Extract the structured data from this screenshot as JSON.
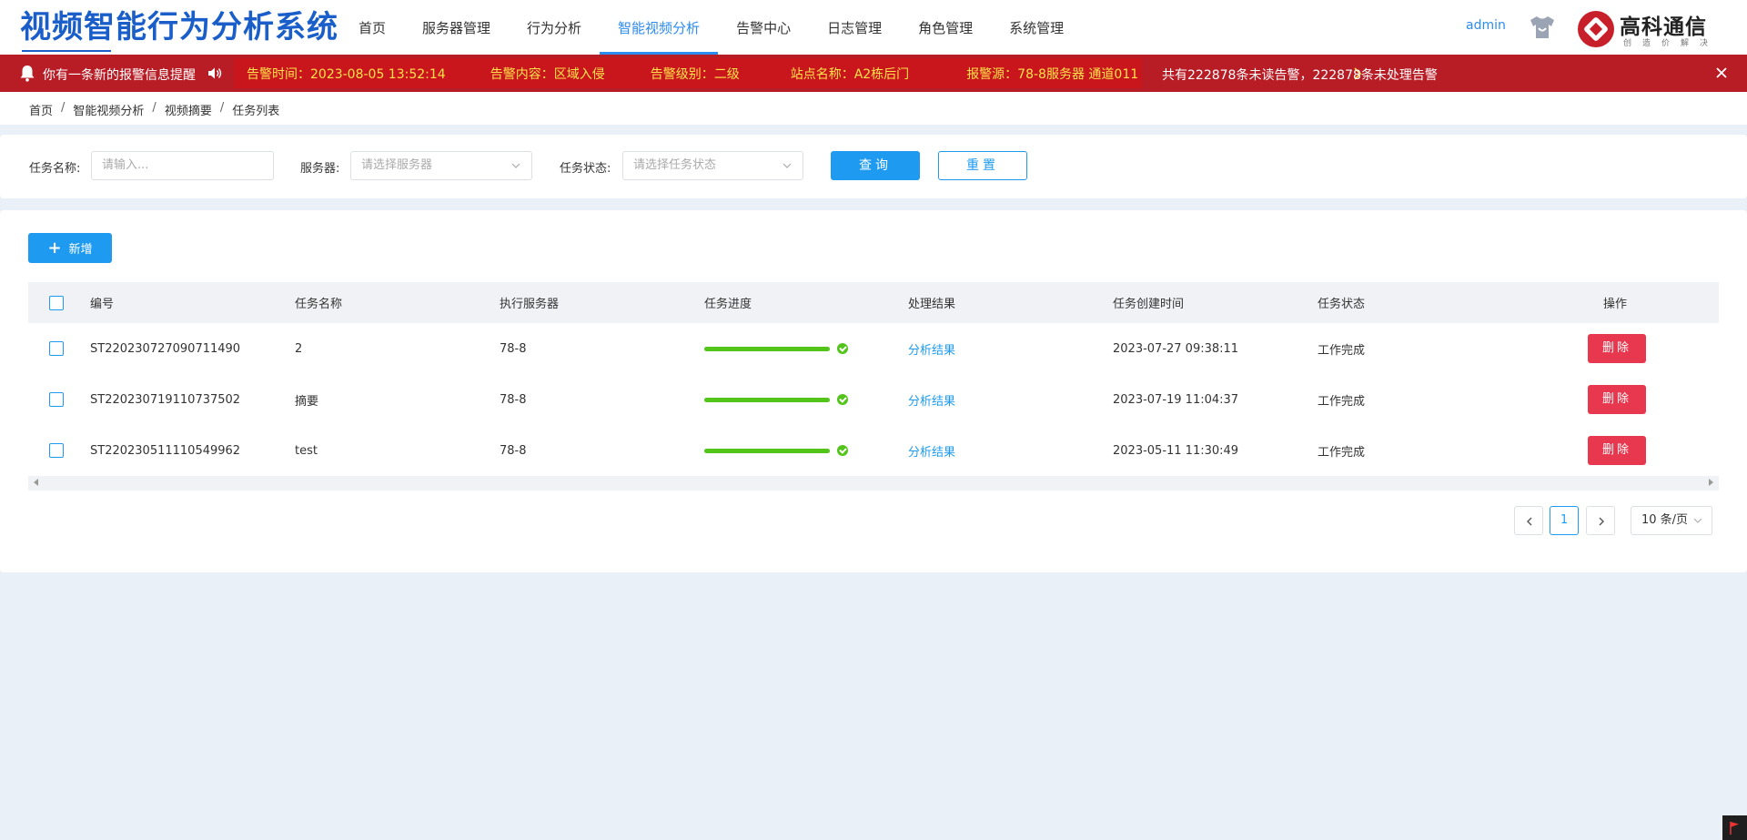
{
  "header": {
    "app_title": "视频智能行为分析系统",
    "nav": [
      "首页",
      "服务器管理",
      "行为分析",
      "智能视频分析",
      "告警中心",
      "日志管理",
      "角色管理",
      "系统管理"
    ],
    "active_nav": "智能视频分析",
    "user": "admin",
    "logo_text": "高科通信",
    "logo_slogan": "创造价解决"
  },
  "alarm": {
    "tip": "你有一条新的报警信息提醒",
    "time": "告警时间：2023-08-05 13:52:14",
    "content": "告警内容：区域入侵",
    "level": "告警级别：二级",
    "site": "站点名称：A2栋后门",
    "source": "报警源：78-8服务器 通道011",
    "summary": "共有222878条未读告警，222878条未处理告警"
  },
  "breadcrumb": [
    "首页",
    "智能视频分析",
    "视频摘要",
    "任务列表"
  ],
  "search": {
    "task_name_label": "任务名称:",
    "task_name_placeholder": "请输入...",
    "server_label": "服务器:",
    "server_placeholder": "请选择服务器",
    "status_label": "任务状态:",
    "status_placeholder": "请选择任务状态",
    "query_label": "查询",
    "reset_label": "重置"
  },
  "toolbar": {
    "add_label": "新增"
  },
  "table": {
    "columns": [
      "编号",
      "任务名称",
      "执行服务器",
      "任务进度",
      "处理结果",
      "任务创建时间",
      "任务状态",
      "操作"
    ],
    "rows": [
      {
        "id": "ST220230727090711490",
        "name": "2",
        "server": "78-8",
        "progress": 1.0,
        "result": "分析结果",
        "created": "2023-07-27 09:38:11",
        "status": "工作完成",
        "action": "删除"
      },
      {
        "id": "ST220230719110737502",
        "name": "摘要",
        "server": "78-8",
        "progress": 1.0,
        "result": "分析结果",
        "created": "2023-07-19 11:04:37",
        "status": "工作完成",
        "action": "删除"
      },
      {
        "id": "ST220230511110549962",
        "name": "test",
        "server": "78-8",
        "progress": 1.0,
        "result": "分析结果",
        "created": "2023-05-11 11:30:49",
        "status": "工作完成",
        "action": "删除"
      }
    ]
  },
  "pagination": {
    "current_page": "1",
    "page_size": "10 条/页"
  },
  "colors": {
    "brand": "#1a5ec9",
    "accent": "#1e9bf0",
    "alarm_bg": "#b81c25",
    "danger": "#e8384f",
    "success": "#52c41a"
  }
}
